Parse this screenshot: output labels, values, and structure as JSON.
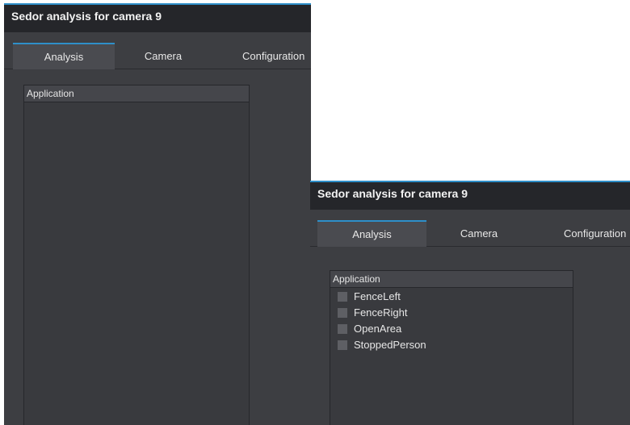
{
  "window_before": {
    "title": "Sedor analysis for camera 9",
    "tabs": [
      {
        "label": "Analysis",
        "active": true
      },
      {
        "label": "Camera",
        "active": false
      },
      {
        "label": "Configuration",
        "active": false
      }
    ],
    "application_panel": {
      "header": "Application",
      "items": []
    }
  },
  "window_after": {
    "title": "Sedor analysis for camera 9",
    "tabs": [
      {
        "label": "Analysis",
        "active": true
      },
      {
        "label": "Camera",
        "active": false
      },
      {
        "label": "Configuration",
        "active": false
      }
    ],
    "application_panel": {
      "header": "Application",
      "items": [
        {
          "label": "FenceLeft",
          "checked": false
        },
        {
          "label": "FenceRight",
          "checked": false
        },
        {
          "label": "OpenArea",
          "checked": false
        },
        {
          "label": "StoppedPerson",
          "checked": false
        }
      ]
    }
  },
  "colors": {
    "accent": "#2e8fc9",
    "window_background": "#3d3e42",
    "titlebar_background": "#25262a",
    "checkbox": "#5e5f64"
  }
}
